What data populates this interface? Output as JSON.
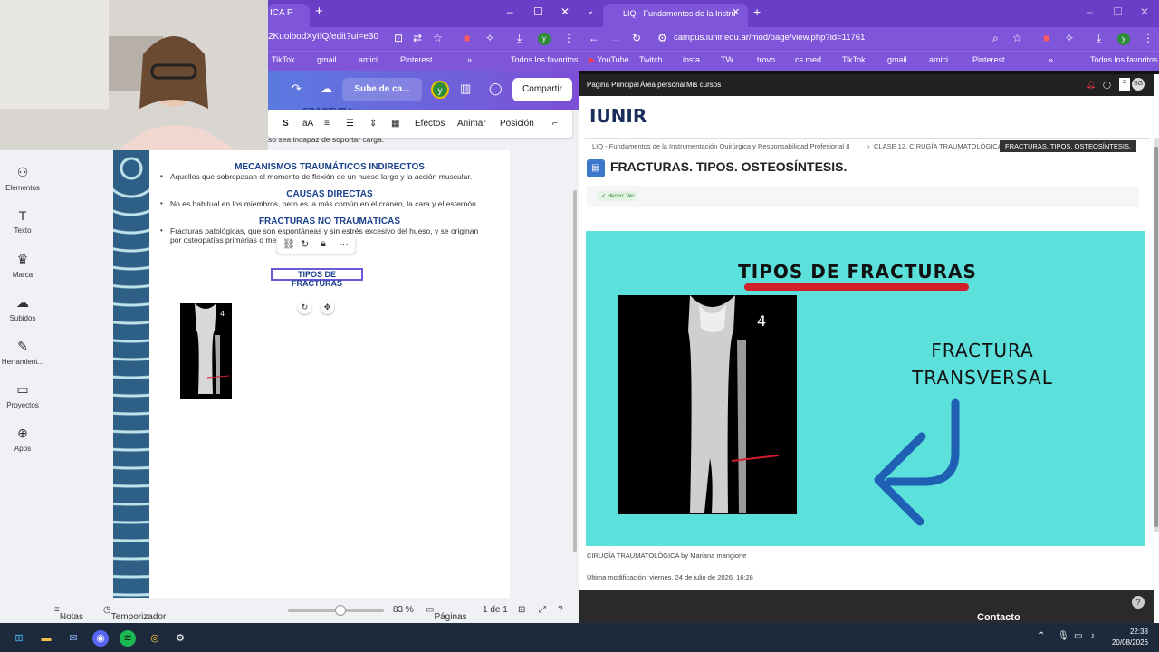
{
  "left_window": {
    "tab_title": "ICA P",
    "url": "2KuoibodXyIfQ/edit?ui=e30",
    "bookmarks": [
      "TikTok",
      "gmail",
      "amici",
      "Pinterest"
    ],
    "bookmarks_folder": "Todos los favoritos",
    "canva_toolbar": {
      "upload_label": "Sube de ca...",
      "share_label": "Compartir",
      "avatar_letter": "y"
    },
    "text_toolbar": {
      "font_size_icon": "aA",
      "effects": "Efectos",
      "animate": "Animar",
      "position": "Posición"
    },
    "sidebar": [
      {
        "label": "Elementos",
        "icon": "elements-icon"
      },
      {
        "label": "Texto",
        "icon": "text-icon"
      },
      {
        "label": "Marca",
        "icon": "brand-icon"
      },
      {
        "label": "Subidos",
        "icon": "uploads-icon"
      },
      {
        "label": "Herramient...",
        "icon": "tools-icon"
      },
      {
        "label": "Proyectos",
        "icon": "projects-icon"
      },
      {
        "label": "Apps",
        "icon": "apps-icon"
      }
    ],
    "document": {
      "cut_heading": "FRACTURA:",
      "cut_text": "so sea incapaz de soportar carga.",
      "sections": [
        {
          "heading": "MECANISMOS TRAUMÁTICOS INDIRECTOS",
          "text": "Aquellos que sobrepasan el momento de flexión de un hueso largo y la acción muscular."
        },
        {
          "heading": "CAUSAS DIRECTAS",
          "text": "No es habitual en los miembros, pero es la más común en el cráneo, la cara y el esternón."
        },
        {
          "heading": "FRACTURAS NO TRAUMÁTICAS",
          "text": "Fracturas patológicas, que son espontáneas y sin estrés excesivo del hueso, y se originan",
          "text2": "por osteopatías primarias o me"
        }
      ],
      "selected_text": "TIPOS DE FRACTURAS"
    },
    "footer": {
      "notes": "Notas",
      "timer": "Temporizador",
      "zoom": "83 %",
      "pages": "Páginas",
      "page_count": "1 de 1"
    }
  },
  "right_window": {
    "tab_title": "LIQ - Fundamentos de la Instru",
    "url": "campus.iunir.edu.ar/mod/page/view.php?id=11761",
    "bookmarks": [
      "YouTube",
      "Twitch",
      "insta",
      "TW",
      "trovo",
      "cs med",
      "TikTok",
      "gmail",
      "amici",
      "Pinterest"
    ],
    "bookmarks_folder": "Todos los favoritos",
    "nav": [
      "Página Principal",
      "Área personal",
      "Mis cursos"
    ],
    "logo": "IUNIR",
    "avatar": "SG",
    "breadcrumb": [
      "LIQ - Fundamentos de la Instrumentación Quirúrgica y Responsabilidad Profesional II",
      "CLASE 12. CIRUGÍA TRAUMATOLÓGICA",
      "FRACTURAS. TIPOS. OSTEOSÍNTESIS."
    ],
    "page_title": "FRACTURAS. TIPOS. OSTEOSÍNTESIS.",
    "done_badge": "✓ Hecho: Ver",
    "slide": {
      "title": "TIPOS DE FRACTURAS",
      "label_line1": "FRACTURA",
      "label_line2": "TRANSVERSAL",
      "xray_marker": "4",
      "bg_color": "#5ce0dc",
      "underline_color": "#d11e2b",
      "arrow_color": "#1f5fb4"
    },
    "caption": "CIRUGÍA TRAUMATOLÓGICA by Mariana mangione",
    "modified": "Última modificación: viernes, 24 de julio de 2026, 16:28",
    "footer_contact": "Contacto"
  },
  "taskbar": {
    "time": "22:33",
    "date": "20/08/2026"
  },
  "colors": {
    "browser_purple": "#7f55d9",
    "canva_gradient_start": "#5b7ae0",
    "heading_blue": "#1a3f8c"
  }
}
